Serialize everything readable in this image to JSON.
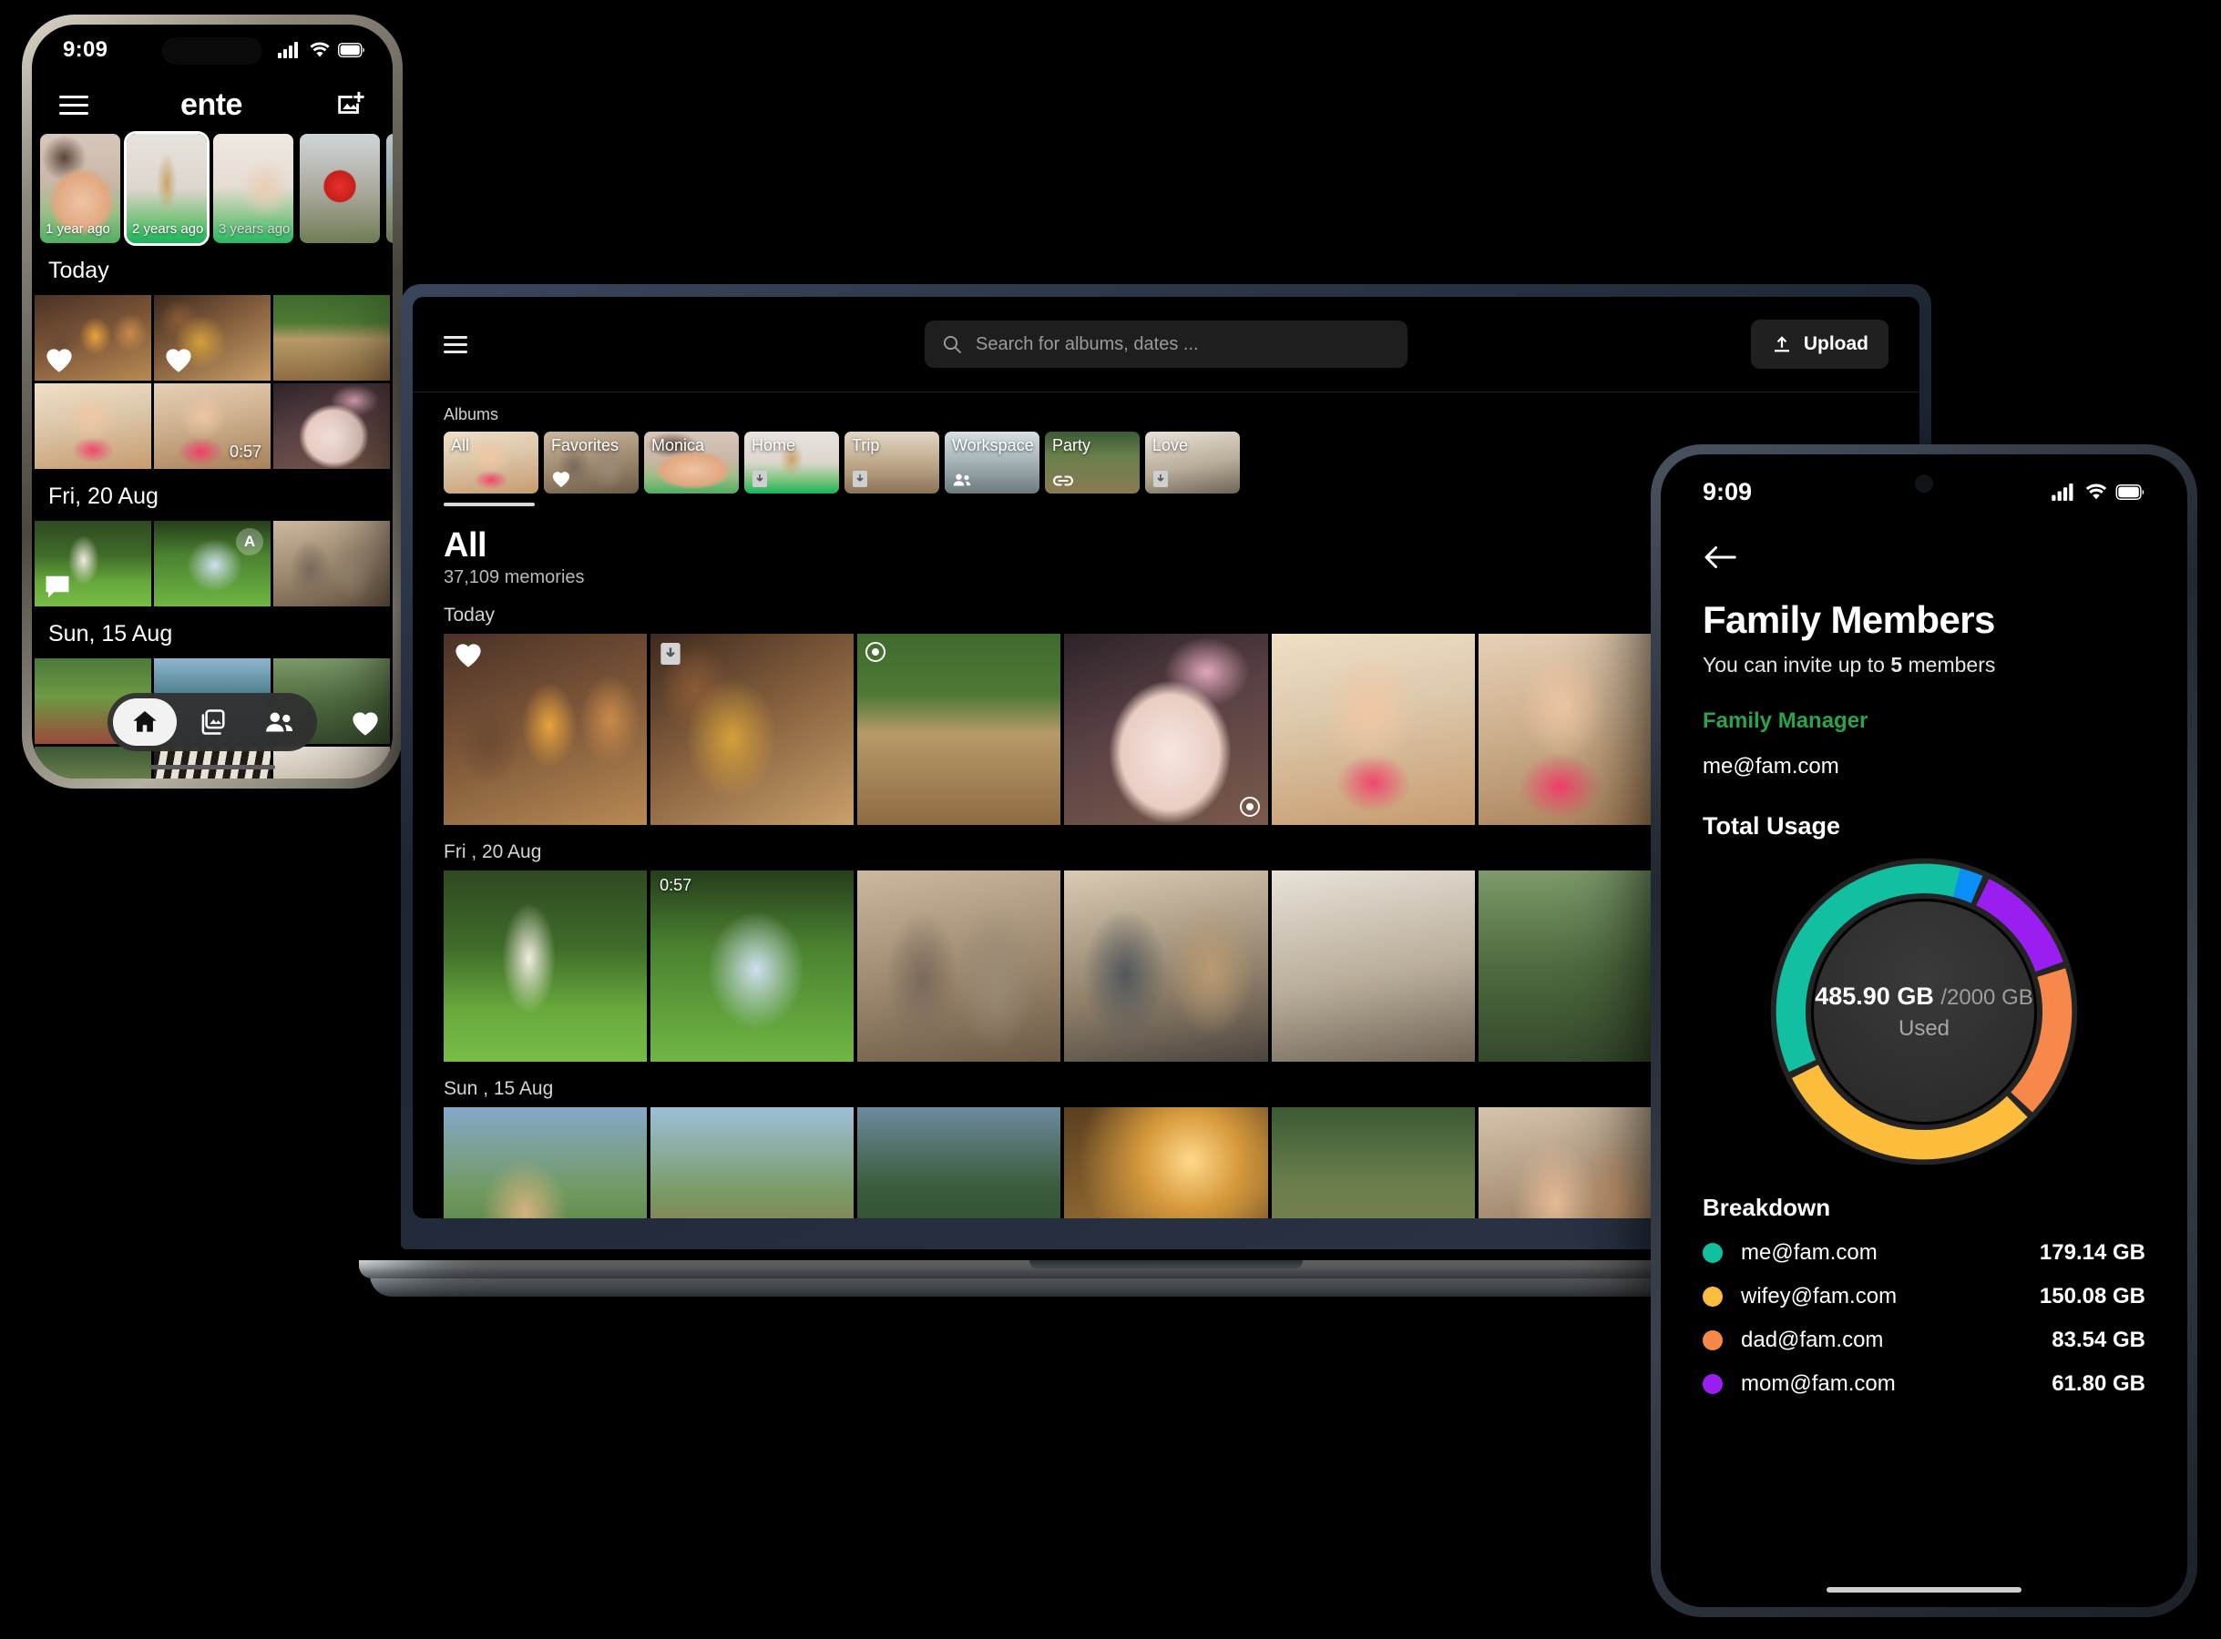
{
  "phone_left": {
    "status": {
      "time": "9:09"
    },
    "appbar": {
      "brand": "ente",
      "menu_label": "Menu",
      "add_label": "Add photos"
    },
    "memories": [
      {
        "label": "1 year ago"
      },
      {
        "label": "2 years ago"
      },
      {
        "label": "3 years ago"
      },
      {
        "label": ""
      },
      {
        "label": ""
      }
    ],
    "sections": [
      {
        "title": "Today"
      },
      {
        "title": "Fri, 20 Aug"
      },
      {
        "title": "Sun, 15 Aug"
      }
    ],
    "badges": {
      "video_duration": "0:57",
      "archive": "A"
    },
    "nav": [
      {
        "name": "home"
      },
      {
        "name": "library"
      },
      {
        "name": "shared"
      }
    ]
  },
  "laptop": {
    "search": {
      "placeholder": "Search for albums, dates ..."
    },
    "upload": {
      "label": "Upload"
    },
    "albums_label": "Albums",
    "albums": [
      {
        "name": "All",
        "icon": ""
      },
      {
        "name": "Favorites",
        "icon": "heart"
      },
      {
        "name": "Monica",
        "icon": ""
      },
      {
        "name": "Home",
        "icon": "device"
      },
      {
        "name": "Trip",
        "icon": "device"
      },
      {
        "name": "Workspace",
        "icon": "people"
      },
      {
        "name": "Party",
        "icon": "link"
      },
      {
        "name": "Love",
        "icon": "device"
      }
    ],
    "header": {
      "title": "All",
      "subtitle": "37,109 memories"
    },
    "sections": [
      {
        "title": "Today"
      },
      {
        "title": "Fri , 20 Aug"
      },
      {
        "title": "Sun , 15 Aug"
      }
    ],
    "badges": {
      "video_duration": "0:57"
    }
  },
  "phone_right": {
    "status": {
      "time": "9:09"
    },
    "back_label": "Back",
    "title": "Family Members",
    "subtitle_pre": "You can invite up to ",
    "subtitle_bold": "5",
    "subtitle_post": " members",
    "manager_label": "Family Manager",
    "manager_email": "me@fam.com",
    "usage_title": "Total Usage",
    "donut_center": {
      "used": "485.90 GB",
      "total": "/2000 GB",
      "caption": "Used"
    },
    "breakdown_title": "Breakdown",
    "breakdown": [
      {
        "color": "#12bfa0",
        "email": "me@fam.com",
        "size": "179.14 GB"
      },
      {
        "color": "#fcbc3c",
        "email": "wifey@fam.com",
        "size": "150.08 GB"
      },
      {
        "color": "#f7884a",
        "email": "dad@fam.com",
        "size": "83.54 GB"
      },
      {
        "color": "#9b1ef0",
        "email": "mom@fam.com",
        "size": "61.80 GB"
      }
    ]
  },
  "chart_data": {
    "type": "pie",
    "title": "Total Usage",
    "unit": "GB",
    "total_capacity": 2000,
    "total_used": 485.9,
    "legend_position": "below",
    "categories": [
      "me@fam.com",
      "wifey@fam.com",
      "dad@fam.com",
      "mom@fam.com",
      "other"
    ],
    "values": [
      179.14,
      150.08,
      83.54,
      61.8,
      11.34
    ],
    "colors": [
      "#12bfa0",
      "#fcbc3c",
      "#f7884a",
      "#9b1ef0",
      "#0b8ef5"
    ]
  }
}
